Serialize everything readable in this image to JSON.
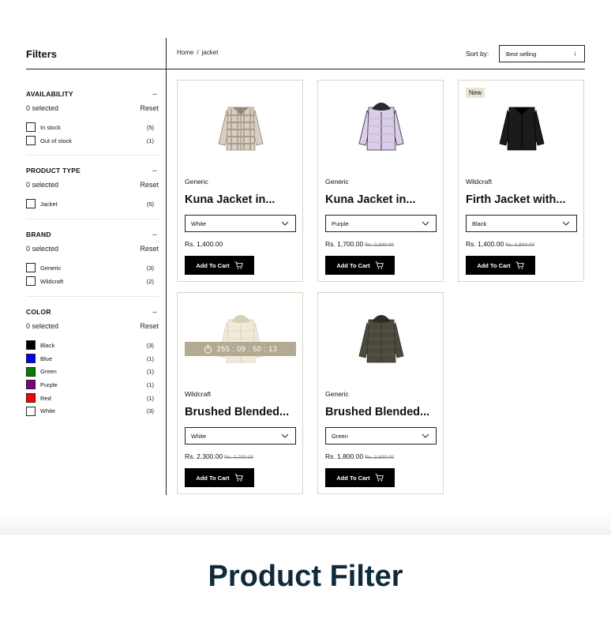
{
  "sidebar": {
    "title": "Filters",
    "sections": [
      {
        "title": "AVAILABILITY",
        "selected": "0 selected",
        "reset": "Reset",
        "options": [
          {
            "label": "In stock",
            "count": "(5)"
          },
          {
            "label": "Out of stock",
            "count": "(1)"
          }
        ]
      },
      {
        "title": "PRODUCT TYPE",
        "selected": "0 selected",
        "reset": "Reset",
        "options": [
          {
            "label": "Jacket",
            "count": "(5)"
          }
        ]
      },
      {
        "title": "BRAND",
        "selected": "0 selected",
        "reset": "Reset",
        "options": [
          {
            "label": "Generic",
            "count": "(3)"
          },
          {
            "label": "Wildcraft",
            "count": "(2)"
          }
        ]
      },
      {
        "title": "COLOR",
        "selected": "0 selected",
        "reset": "Reset",
        "options": [
          {
            "label": "Black",
            "count": "(3)",
            "color": "#000000"
          },
          {
            "label": "Blue",
            "count": "(1)",
            "color": "#0000ff"
          },
          {
            "label": "Green",
            "count": "(1)",
            "color": "#008000"
          },
          {
            "label": "Purple",
            "count": "(1)",
            "color": "#800080"
          },
          {
            "label": "Red",
            "count": "(1)",
            "color": "#ff0000"
          },
          {
            "label": "White",
            "count": "(3)",
            "color": "#ffffff"
          }
        ]
      }
    ]
  },
  "topbar": {
    "breadcrumb": [
      "Home",
      "/",
      "jacket"
    ],
    "sort_label": "Sort by:",
    "sort_value": "Best selling",
    "sort_icon": "arrow-down-icon"
  },
  "products": [
    {
      "brand": "Generic",
      "name": "Kuna Jacket in...",
      "variant": "White",
      "price": "Rs. 1,400.00",
      "old_price": "",
      "cart_label": "Add To Cart",
      "badge": "",
      "timer": "",
      "image": "plaid-shacket"
    },
    {
      "brand": "Generic",
      "name": "Kuna Jacket in...",
      "variant": "Purple",
      "price": "Rs. 1,700.00",
      "old_price": "Rs. 2,300.00",
      "cart_label": "Add To Cart",
      "badge": "",
      "timer": "",
      "image": "lilac-puffer"
    },
    {
      "brand": "Wildcraft",
      "name": "Firth Jacket with...",
      "variant": "Black",
      "price": "Rs. 1,400.00",
      "old_price": "Rs. 1,800.00",
      "cart_label": "Add To Cart",
      "badge": "New",
      "timer": "",
      "image": "black-fleece"
    },
    {
      "brand": "Wildcraft",
      "name": "Brushed Blended...",
      "variant": "White",
      "price": "Rs. 2,300.00",
      "old_price": "Rs. 2,700.00",
      "cart_label": "Add To Cart",
      "badge": "",
      "timer": "255 : 09 : 50 : 13",
      "image": "cream-puffer"
    },
    {
      "brand": "Generic",
      "name": "Brushed Blended...",
      "variant": "Green",
      "price": "Rs. 1,800.00",
      "old_price": "Rs. 2,300.00",
      "cart_label": "Add To Cart",
      "badge": "",
      "timer": "",
      "image": "olive-parka"
    }
  ],
  "footer": {
    "title": "Product Filter",
    "title_color": "#0f2a3a"
  },
  "colors": {
    "card_border": "#d9d6c6",
    "timer_bg": "#b3aa92",
    "badge_bg": "#e9e6d6",
    "button_bg": "#000000"
  }
}
